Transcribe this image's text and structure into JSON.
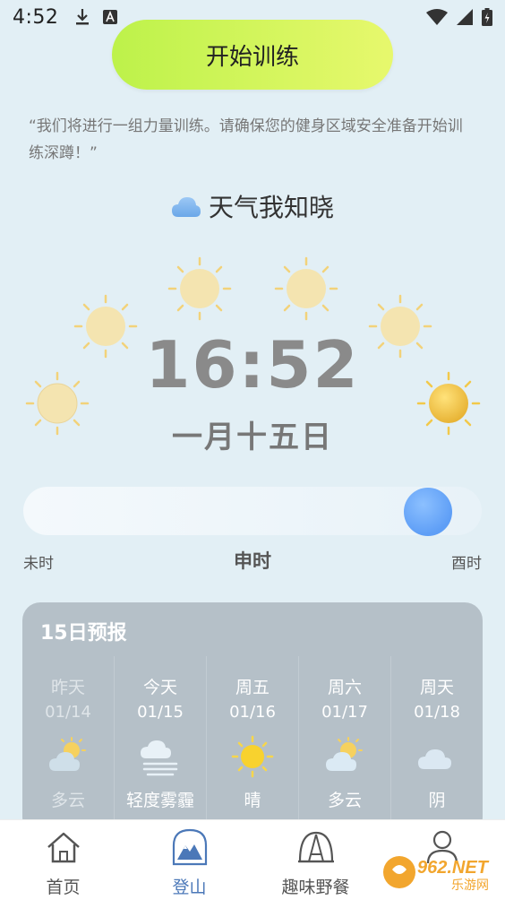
{
  "status_bar": {
    "time": "4:52"
  },
  "start_button": {
    "label": "开始训练"
  },
  "quote": {
    "text": "“我们将进行一组力量训练。请确保您的健身区域安全准备开始训练深蹲！”"
  },
  "weather": {
    "title": "天气我知晓"
  },
  "clock": {
    "time": "16:52",
    "lunar_date": "一月十五日"
  },
  "time_slider": {
    "left_label": "未时",
    "current_label": "申时",
    "right_label": "酉时"
  },
  "forecast": {
    "title": "15日预报",
    "days": [
      {
        "day": "昨天",
        "date": "01/14",
        "condition": "多云",
        "icon": "partly-cloudy-icon"
      },
      {
        "day": "今天",
        "date": "01/15",
        "condition": "轻度雾霾",
        "icon": "haze-icon"
      },
      {
        "day": "周五",
        "date": "01/16",
        "condition": "晴",
        "icon": "sunny-icon"
      },
      {
        "day": "周六",
        "date": "01/17",
        "condition": "多云",
        "icon": "partly-cloudy-icon"
      },
      {
        "day": "周天",
        "date": "01/18",
        "condition": "阴",
        "icon": "cloudy-icon"
      }
    ]
  },
  "nav": {
    "items": [
      {
        "label": "首页",
        "icon": "home-icon"
      },
      {
        "label": "登山",
        "icon": "mountain-icon"
      },
      {
        "label": "趣味野餐",
        "icon": "tent-icon"
      },
      {
        "label": "",
        "icon": "profile-icon"
      }
    ]
  },
  "watermark": {
    "text": "962.NET",
    "sub": "乐游网"
  }
}
